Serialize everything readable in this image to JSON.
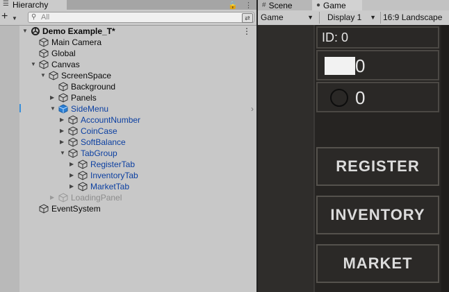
{
  "hierarchy": {
    "tab_label": "Hierarchy",
    "search_placeholder": "All",
    "scene_name": "Demo Example_T*",
    "items": [
      {
        "label": "Main Camera"
      },
      {
        "label": "Global"
      },
      {
        "label": "Canvas"
      },
      {
        "label": "ScreenSpace"
      },
      {
        "label": "Background"
      },
      {
        "label": "Panels"
      },
      {
        "label": "SideMenu"
      },
      {
        "label": "AccountNumber"
      },
      {
        "label": "CoinCase"
      },
      {
        "label": "SoftBalance"
      },
      {
        "label": "TabGroup"
      },
      {
        "label": "RegisterTab"
      },
      {
        "label": "InventoryTab"
      },
      {
        "label": "MarketTab"
      },
      {
        "label": "LoadingPanel"
      },
      {
        "label": "EventSystem"
      }
    ]
  },
  "game_view": {
    "tabs": [
      {
        "label": "Scene"
      },
      {
        "label": "Game"
      }
    ],
    "view_select": "Game",
    "display_select": "Display 1",
    "aspect_select": "16:9 Landscape",
    "id_label": "ID: 0",
    "balance_value": "0",
    "coin_value": "0",
    "buttons": [
      "REGISTER",
      "INVENTORY",
      "MARKET"
    ]
  },
  "colors": {
    "selected_text": "#0b3fa1",
    "selected_marker": "#3a8fd8",
    "game_bg": "#2f2d2b"
  }
}
